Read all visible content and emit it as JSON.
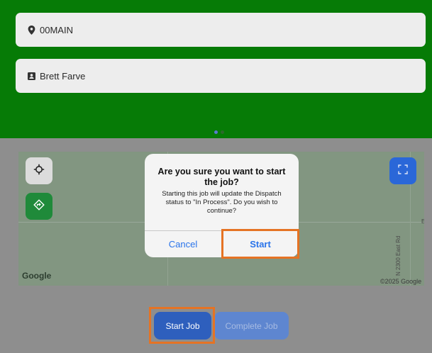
{
  "form": {
    "location": "00MAIN",
    "contact": "Brett Farve"
  },
  "map": {
    "road_label": "N 2300 East Rd",
    "edge_label": "E",
    "logo": "Google",
    "copyright": "©2025 Google"
  },
  "dialog": {
    "title": "Are you sure you want to start the job?",
    "message": "Starting this job will update the Dispatch status to \"In Process\". Do you wish to continue?",
    "cancel_label": "Cancel",
    "confirm_label": "Start"
  },
  "actions": {
    "start_job": "Start Job",
    "complete_job": "Complete Job"
  },
  "colors": {
    "header_green": "#067b06",
    "accent_blue": "#2a74ea",
    "highlight_orange": "#e57324"
  },
  "icons": {
    "location": "location-pin-icon",
    "contact": "contact-card-icon",
    "locate": "crosshair-icon",
    "navigate": "directions-icon",
    "expand": "fullscreen-icon"
  }
}
